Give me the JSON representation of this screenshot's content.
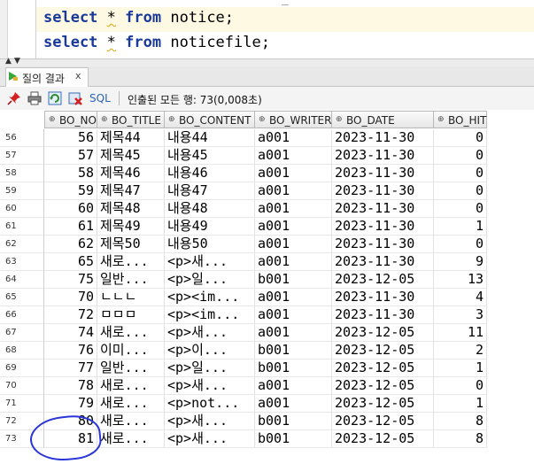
{
  "editor": {
    "top_fragment": "_",
    "lines": [
      {
        "kw1": "select",
        "star": "*",
        "kw2": "from",
        "rest": "notice;"
      },
      {
        "kw1": "select",
        "star": "*",
        "kw2": "from",
        "rest": "noticefile;"
      }
    ]
  },
  "splitter": {
    "up": "▲",
    "down": "▼"
  },
  "tab": {
    "label": "질의 결과",
    "close": "x",
    "icon": "query-result-icon"
  },
  "toolbar": {
    "icons": [
      "pin-icon",
      "print-icon",
      "refresh-icon",
      "delete-icon"
    ],
    "sql_label": "SQL",
    "status": "인출된 모든 행: 73(0,008초)"
  },
  "columns": [
    {
      "name": "BO_NO"
    },
    {
      "name": "BO_TITLE"
    },
    {
      "name": "BO_CONTENT"
    },
    {
      "name": "BO_WRITER"
    },
    {
      "name": "BO_DATE"
    },
    {
      "name": "BO_HIT"
    }
  ],
  "rows": [
    [
      "56",
      "56",
      "제목44",
      "내용44",
      "a001",
      "2023-11-30",
      "0"
    ],
    [
      "57",
      "57",
      "제목45",
      "내용45",
      "a001",
      "2023-11-30",
      "0"
    ],
    [
      "58",
      "58",
      "제목46",
      "내용46",
      "a001",
      "2023-11-30",
      "0"
    ],
    [
      "59",
      "59",
      "제목47",
      "내용47",
      "a001",
      "2023-11-30",
      "0"
    ],
    [
      "60",
      "60",
      "제목48",
      "내용48",
      "a001",
      "2023-11-30",
      "0"
    ],
    [
      "61",
      "61",
      "제목49",
      "내용49",
      "a001",
      "2023-11-30",
      "1"
    ],
    [
      "62",
      "62",
      "제목50",
      "내용50",
      "a001",
      "2023-11-30",
      "0"
    ],
    [
      "63",
      "65",
      "새로...",
      "<p>새...",
      "a001",
      "2023-11-30",
      "9"
    ],
    [
      "64",
      "75",
      "일반...",
      "<p>일...",
      "b001",
      "2023-12-05",
      "13"
    ],
    [
      "65",
      "70",
      "ㄴㄴㄴ",
      "<p><im...",
      "a001",
      "2023-11-30",
      "4"
    ],
    [
      "66",
      "72",
      "ㅁㅁㅁ",
      "<p><im...",
      "a001",
      "2023-11-30",
      "3"
    ],
    [
      "67",
      "74",
      "새로...",
      "<p>새...",
      "a001",
      "2023-12-05",
      "11"
    ],
    [
      "68",
      "76",
      "이미...",
      "<p>이...",
      "b001",
      "2023-12-05",
      "2"
    ],
    [
      "69",
      "77",
      "일반...",
      "<p>일...",
      "b001",
      "2023-12-05",
      "1"
    ],
    [
      "70",
      "78",
      "새로...",
      "<p>새...",
      "a001",
      "2023-12-05",
      "0"
    ],
    [
      "71",
      "79",
      "새로...",
      "<p>not...",
      "a001",
      "2023-12-05",
      "1"
    ],
    [
      "72",
      "80",
      "새로...",
      "<p>새...",
      "b001",
      "2023-12-05",
      "8"
    ],
    [
      "73",
      "81",
      "새로...",
      "<p>새...",
      "b001",
      "2023-12-05",
      "8"
    ]
  ],
  "colors": {
    "keyword": "#1a3a9a",
    "annotation": "#2a36d8",
    "sql_link": "#2a63b8"
  }
}
